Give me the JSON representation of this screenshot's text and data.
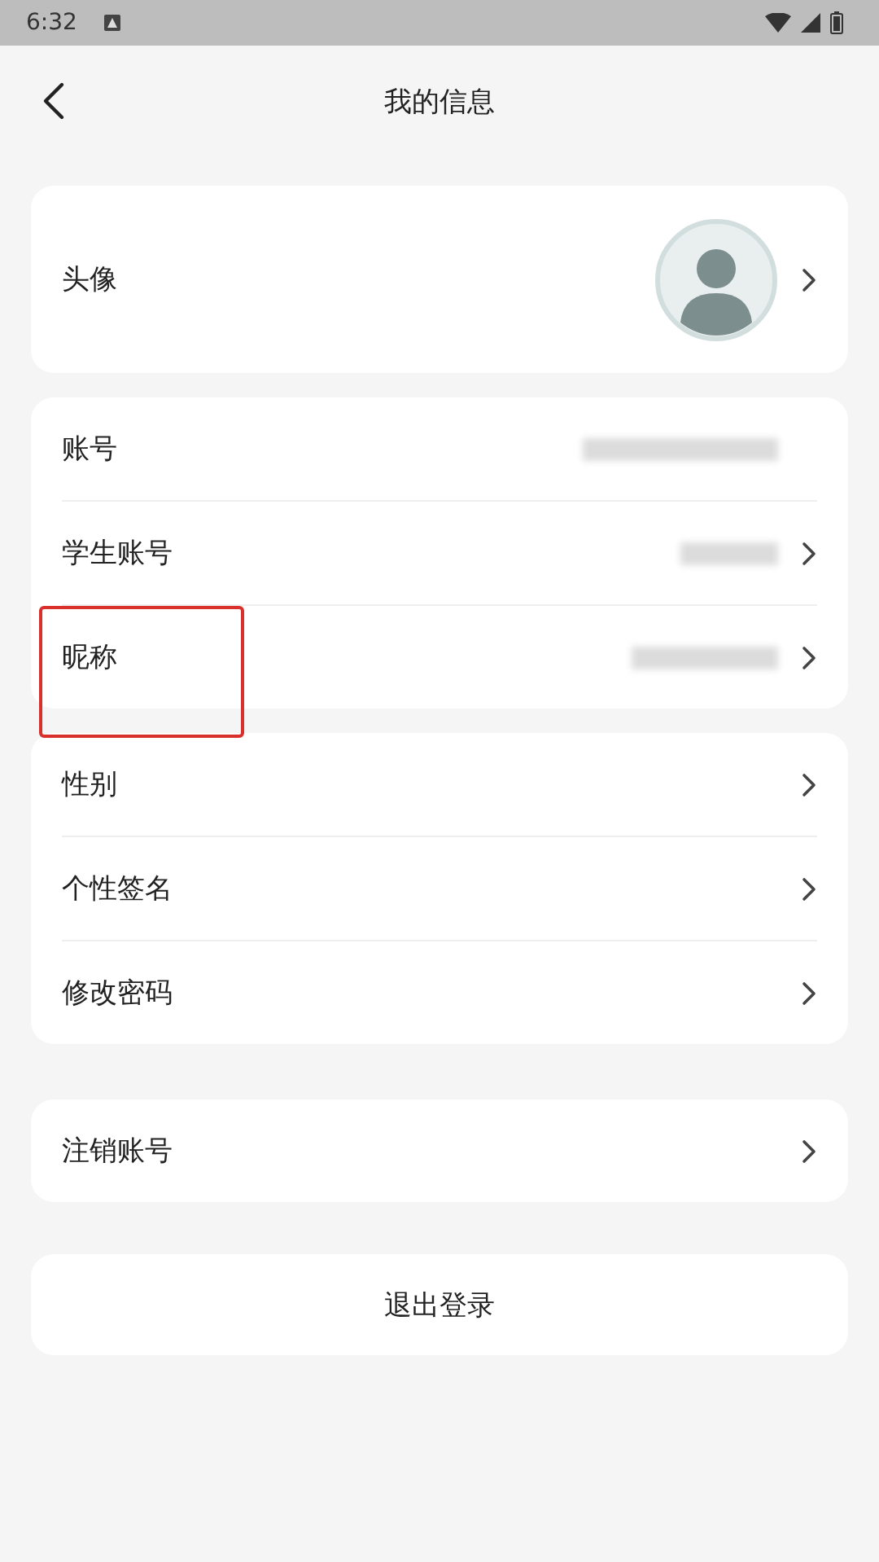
{
  "status_bar": {
    "time": "6:32"
  },
  "header": {
    "title": "我的信息"
  },
  "groups": [
    {
      "rows": [
        {
          "label": "头像",
          "kind": "avatar",
          "redacted": false,
          "chevron": true,
          "highlighted": false
        }
      ]
    },
    {
      "rows": [
        {
          "label": "账号",
          "kind": "value",
          "redacted": true,
          "chevron": false,
          "highlighted": false
        },
        {
          "label": "学生账号",
          "kind": "value",
          "redacted": true,
          "chevron": true,
          "highlighted": false
        },
        {
          "label": "昵称",
          "kind": "value",
          "redacted": true,
          "chevron": true,
          "highlighted": true
        }
      ]
    },
    {
      "rows": [
        {
          "label": "性别",
          "kind": "value",
          "redacted": false,
          "chevron": true,
          "highlighted": false
        },
        {
          "label": "个性签名",
          "kind": "value",
          "redacted": false,
          "chevron": true,
          "highlighted": false
        },
        {
          "label": "修改密码",
          "kind": "value",
          "redacted": false,
          "chevron": true,
          "highlighted": false
        }
      ]
    },
    {
      "rows": [
        {
          "label": "注销账号",
          "kind": "value",
          "redacted": false,
          "chevron": true,
          "highlighted": false
        }
      ]
    }
  ],
  "logout_button": "退出登录"
}
